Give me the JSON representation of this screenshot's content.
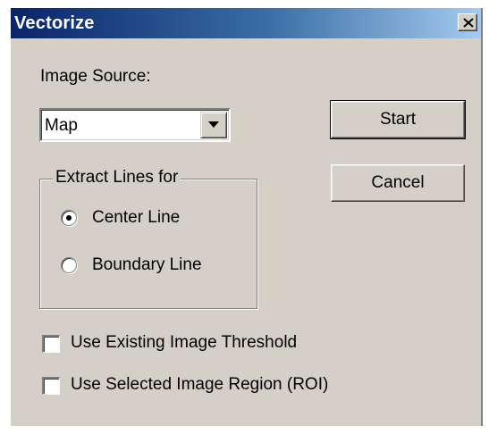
{
  "window": {
    "title": "Vectorize"
  },
  "image_source": {
    "label": "Image Source:",
    "selected_value": "Map"
  },
  "buttons": {
    "start_label": "Start",
    "cancel_label": "Cancel"
  },
  "extract_lines": {
    "group_label": "Extract Lines for",
    "options": [
      {
        "label": "Center Line",
        "selected": true
      },
      {
        "label": "Boundary Line",
        "selected": false
      }
    ]
  },
  "options": {
    "checkboxes": [
      {
        "label": "Use Existing Image Threshold",
        "checked": false
      },
      {
        "label": "Use Selected Image Region (ROI)",
        "checked": false
      }
    ]
  },
  "icons": {
    "close": "close-icon",
    "dropdown": "chevron-down-icon"
  },
  "colors": {
    "title_bar_start": "#0a246a",
    "title_bar_end": "#a6caf0",
    "dialog_face": "#d4d0c8"
  }
}
